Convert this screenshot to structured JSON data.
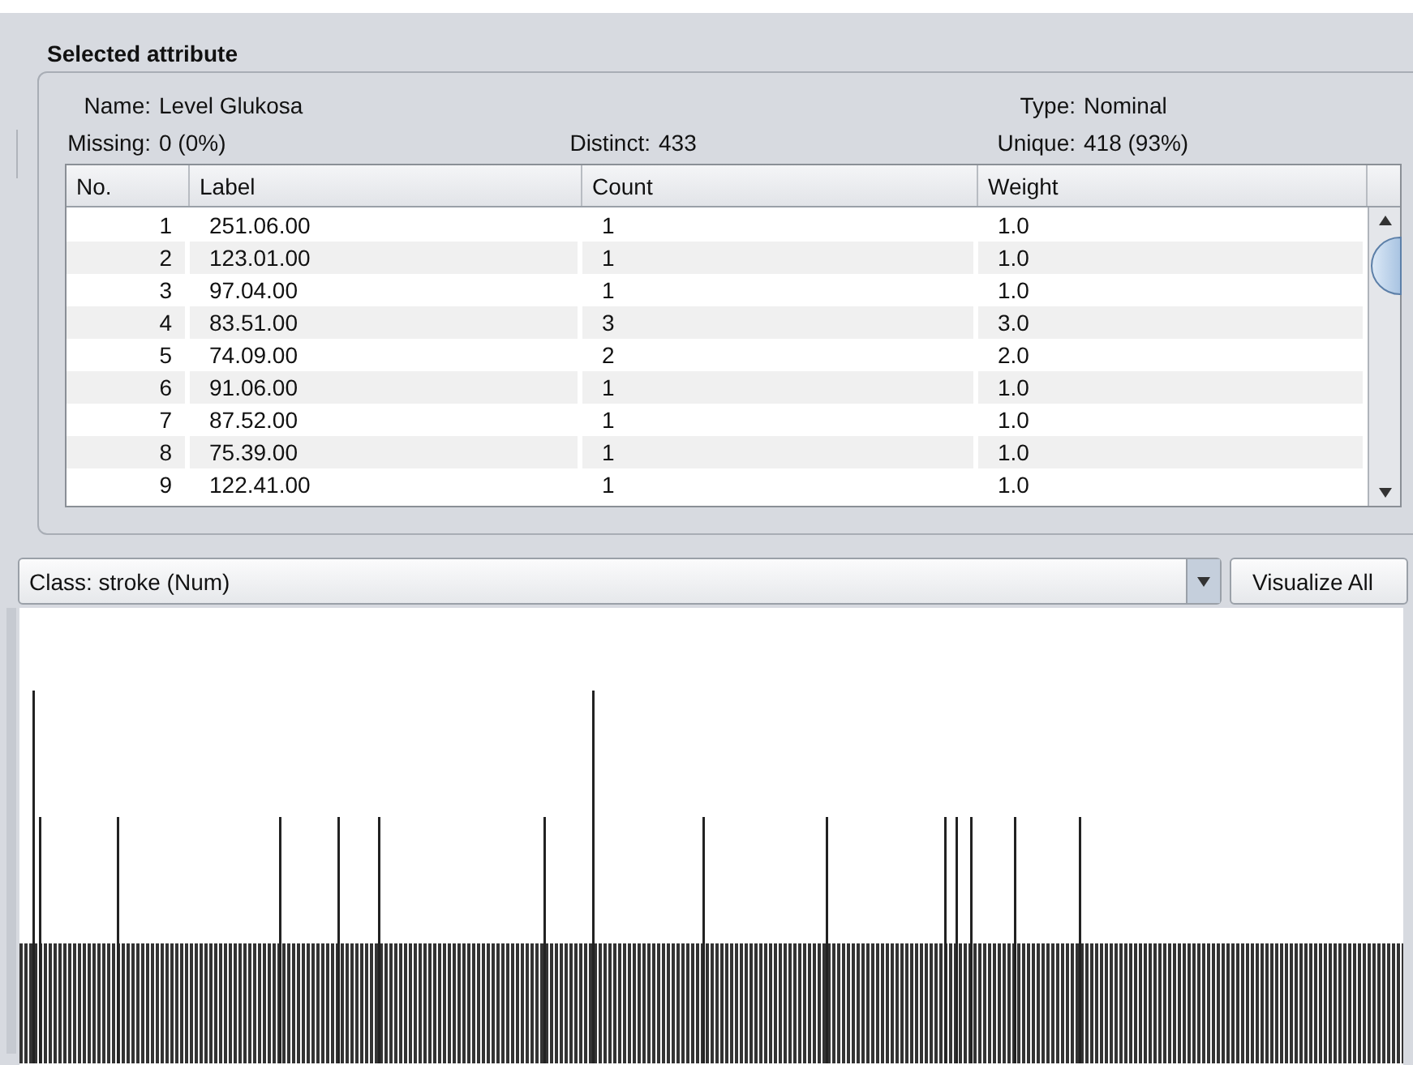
{
  "selected_attribute": {
    "title": "Selected attribute",
    "fields": [
      {
        "label": "Name:",
        "value": "Level Glukosa"
      },
      {
        "label": "Type:",
        "value": "Nominal"
      },
      {
        "label": "Missing:",
        "value": "0 (0%)"
      },
      {
        "label": "Distinct:",
        "value": "433"
      },
      {
        "label": "Unique:",
        "value": "418 (93%)"
      }
    ]
  },
  "table": {
    "columns": [
      "No.",
      "Label",
      "Count",
      "Weight"
    ],
    "rows": [
      [
        "1",
        "251.06.00",
        "1",
        "1.0"
      ],
      [
        "2",
        "123.01.00",
        "1",
        "1.0"
      ],
      [
        "3",
        "97.04.00",
        "1",
        "1.0"
      ],
      [
        "4",
        "83.51.00",
        "3",
        "3.0"
      ],
      [
        "5",
        "74.09.00",
        "2",
        "2.0"
      ],
      [
        "6",
        "91.06.00",
        "1",
        "1.0"
      ],
      [
        "7",
        "87.52.00",
        "1",
        "1.0"
      ],
      [
        "8",
        "75.39.00",
        "1",
        "1.0"
      ],
      [
        "9",
        "122.41.00",
        "1",
        "1.0"
      ]
    ]
  },
  "class_selector": {
    "value": "Class: stroke (Num)"
  },
  "buttons": [
    "Visualize All"
  ]
}
